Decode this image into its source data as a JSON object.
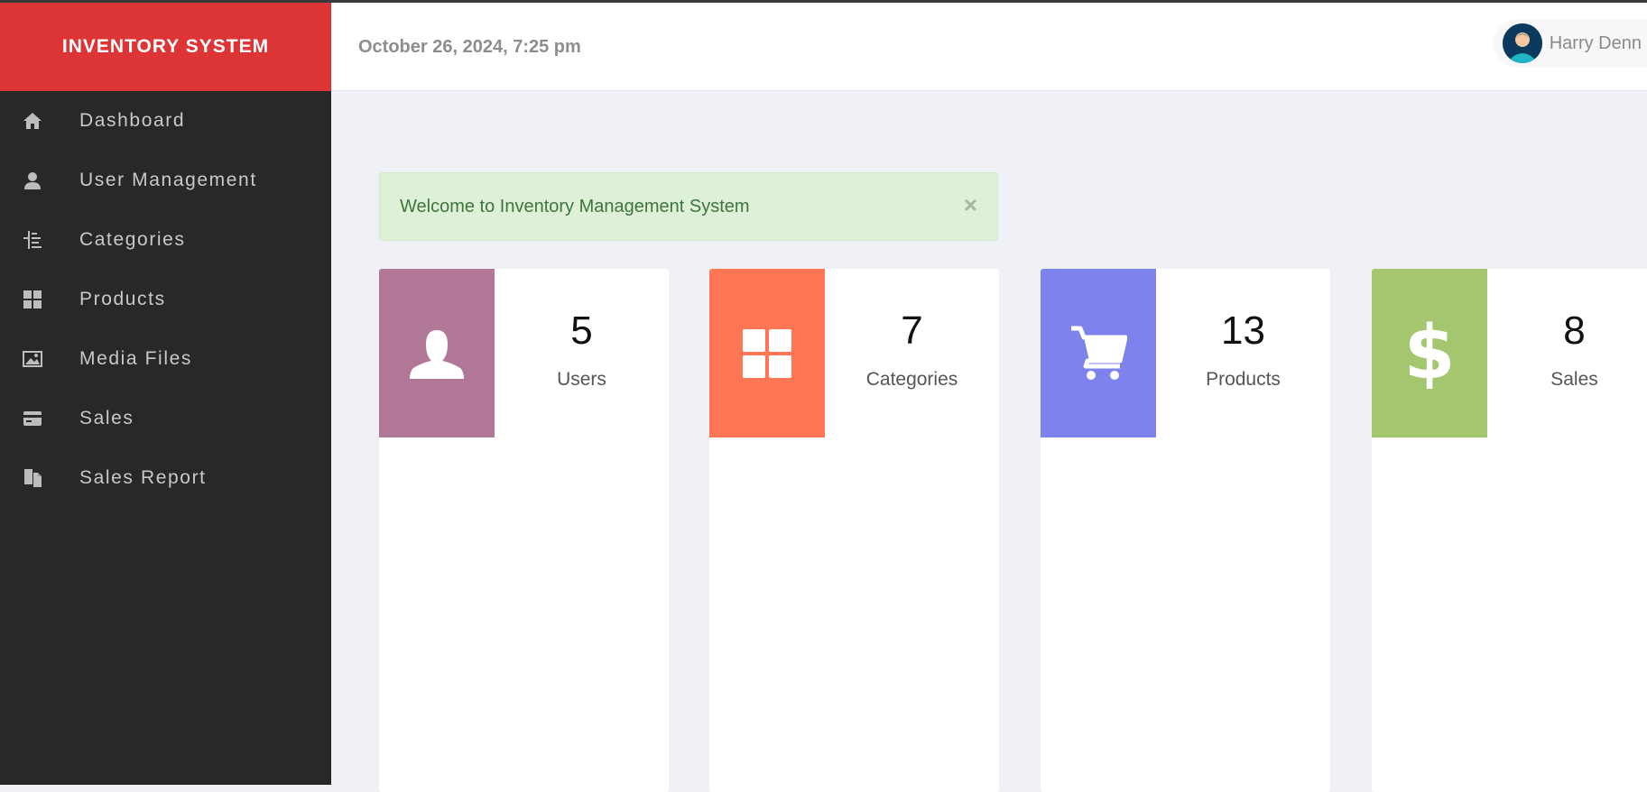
{
  "brand": {
    "title": "INVENTORY SYSTEM",
    "color": "#dd3535"
  },
  "header": {
    "datetime": "October 26, 2024, 7:25 pm",
    "user_name": "Harry Denn",
    "avatar_icon": "user-avatar-icon"
  },
  "sidebar": {
    "items": [
      {
        "label": "Dashboard",
        "icon": "home-icon"
      },
      {
        "label": "User Management",
        "icon": "user-icon"
      },
      {
        "label": "Categories",
        "icon": "indent-icon"
      },
      {
        "label": "Products",
        "icon": "grid-icon"
      },
      {
        "label": "Media Files",
        "icon": "picture-icon"
      },
      {
        "label": "Sales",
        "icon": "credit-card-icon"
      },
      {
        "label": "Sales Report",
        "icon": "duplicate-icon"
      }
    ]
  },
  "alert": {
    "message": "Welcome to Inventory Management System",
    "close": "×"
  },
  "stats": [
    {
      "count": "5",
      "label": "Users",
      "icon": "user-icon",
      "color": "#b07796"
    },
    {
      "count": "7",
      "label": "Categories",
      "icon": "grid-icon",
      "color": "#ff7654"
    },
    {
      "count": "13",
      "label": "Products",
      "icon": "cart-icon",
      "color": "#7d82ec"
    },
    {
      "count": "8",
      "label": "Sales",
      "icon": "dollar-icon",
      "color": "#a3c66e"
    }
  ]
}
